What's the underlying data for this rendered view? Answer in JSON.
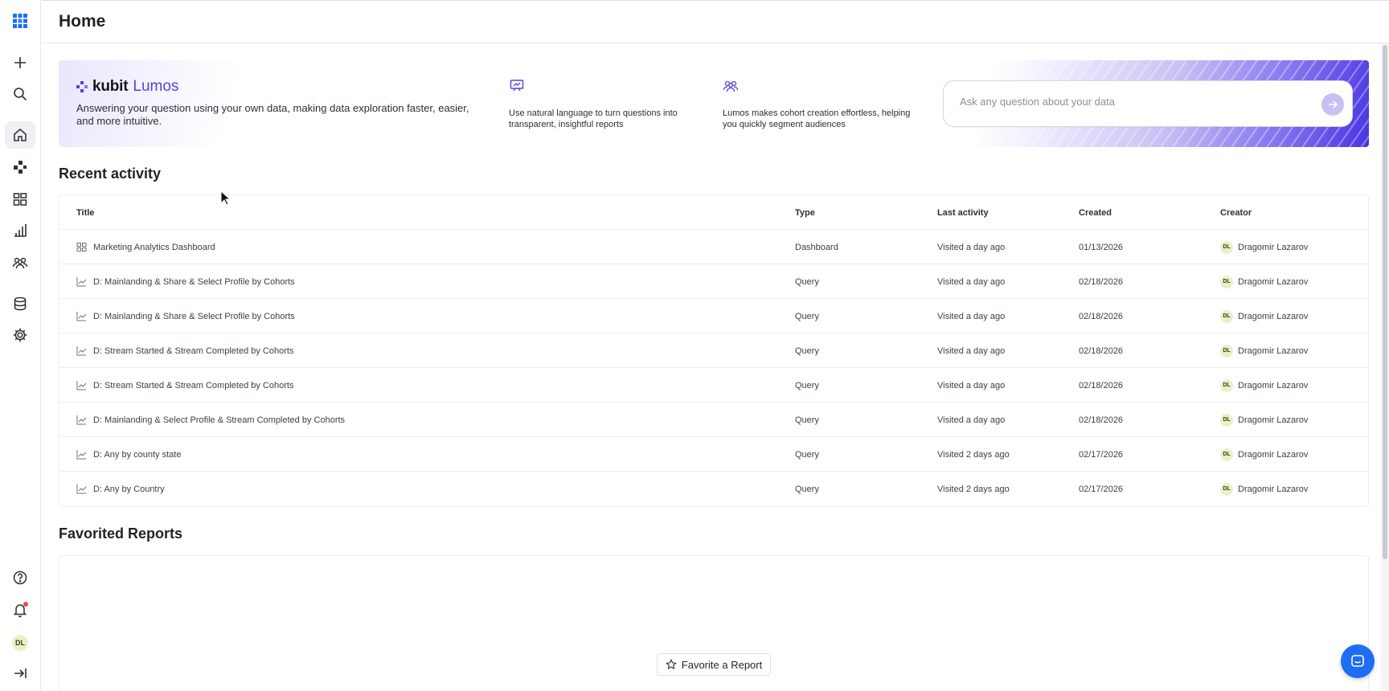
{
  "header": {
    "title": "Home"
  },
  "sidebar": {
    "items": [
      {
        "icon": "grid-logo-icon"
      },
      {
        "icon": "plus-icon"
      },
      {
        "icon": "search-icon"
      },
      {
        "icon": "home-icon",
        "active": true
      },
      {
        "icon": "nodes-icon"
      },
      {
        "icon": "dashboard-icon"
      },
      {
        "icon": "bar-chart-icon"
      },
      {
        "icon": "users-icon"
      },
      {
        "icon": "database-icon"
      },
      {
        "icon": "gear-icon"
      },
      {
        "icon": "help-icon"
      },
      {
        "icon": "bell-icon"
      },
      {
        "icon": "collapse-icon"
      }
    ],
    "avatar_initials": "DL"
  },
  "banner": {
    "brand_kubit": "kubit",
    "brand_lumos": "Lumos",
    "description": "Answering your question using your own data, making data exploration faster, easier, and more intuitive.",
    "feature1": "Use natural language to turn questions into transparent, insightful reports",
    "feature2": "Lumos makes cohort creation effortless, helping you quickly segment audiences",
    "ask_placeholder": "Ask any question about your data"
  },
  "recent": {
    "title": "Recent activity",
    "columns": [
      "Title",
      "Type",
      "Last activity",
      "Created",
      "Creator"
    ],
    "rows": [
      {
        "icon": "dashboard-icon",
        "title": "Marketing Analytics Dashboard",
        "type": "Dashboard",
        "last": "Visited a day ago",
        "created": "01/13/2026",
        "creator": "Dragomir Lazarov",
        "initials": "DL"
      },
      {
        "icon": "line-chart-icon",
        "title": "D: Mainlanding & Share & Select Profile by Cohorts",
        "type": "Query",
        "last": "Visited a day ago",
        "created": "02/18/2026",
        "creator": "Dragomir Lazarov",
        "initials": "DL"
      },
      {
        "icon": "line-chart-icon",
        "title": "D: Mainlanding & Share & Select Profile by Cohorts",
        "type": "Query",
        "last": "Visited a day ago",
        "created": "02/18/2026",
        "creator": "Dragomir Lazarov",
        "initials": "DL"
      },
      {
        "icon": "line-chart-icon",
        "title": "D: Stream Started & Stream Completed by Cohorts",
        "type": "Query",
        "last": "Visited a day ago",
        "created": "02/18/2026",
        "creator": "Dragomir Lazarov",
        "initials": "DL"
      },
      {
        "icon": "line-chart-icon",
        "title": "D: Stream Started & Stream Completed by Cohorts",
        "type": "Query",
        "last": "Visited a day ago",
        "created": "02/18/2026",
        "creator": "Dragomir Lazarov",
        "initials": "DL"
      },
      {
        "icon": "line-chart-icon",
        "title": "D: Mainlanding & Select Profile & Stream Completed by Cohorts",
        "type": "Query",
        "last": "Visited a day ago",
        "created": "02/18/2026",
        "creator": "Dragomir Lazarov",
        "initials": "DL"
      },
      {
        "icon": "line-chart-icon",
        "title": "D: Any by county state",
        "type": "Query",
        "last": "Visited 2 days ago",
        "created": "02/17/2026",
        "creator": "Dragomir Lazarov",
        "initials": "DL"
      },
      {
        "icon": "line-chart-icon",
        "title": "D: Any by Country",
        "type": "Query",
        "last": "Visited 2 days ago",
        "created": "02/17/2026",
        "creator": "Dragomir Lazarov",
        "initials": "DL"
      }
    ]
  },
  "favorited": {
    "title": "Favorited Reports",
    "button_label": "Favorite a Report"
  },
  "colors": {
    "accent": "#5b3fe0",
    "chat": "#1d6ef2",
    "notification": "#e5484d"
  }
}
